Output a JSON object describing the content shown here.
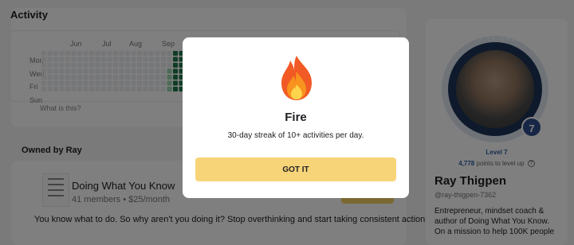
{
  "activity": {
    "title": "Activity",
    "months": [
      "Jun",
      "Jul",
      "Aug",
      "Sep"
    ],
    "days": [
      "Mon",
      "Wed",
      "Fri",
      "Sun"
    ],
    "help_link": "What is this?"
  },
  "owned": {
    "title": "Owned by Ray",
    "group": {
      "name": "Doing What You Know",
      "meta": "41 members • $25/month",
      "description": "You know what to do. So why aren't you doing it? Stop overthinking and start taking consistent action."
    }
  },
  "profile": {
    "avatar_text": "RAY THIGPEN",
    "level_badge": "7",
    "level_label": "Level 7",
    "points_value": "4,778",
    "points_suffix": " points to level up",
    "name": "Ray Thigpen",
    "handle": "@ray-thigpen-7362",
    "bio": "Entrepreneur, mindset coach & author of Doing What You Know. On a mission to help 100K people"
  },
  "modal": {
    "icon": "fire-icon",
    "title": "Fire",
    "text": "30-day streak of 10+ activities per day.",
    "button_label": "GOT IT"
  },
  "colors": {
    "accent": "#f8d479",
    "heat_active": "#1f7a4d",
    "level_blue": "#2f5ea3",
    "overlay": "rgba(0,0,0,0.5)"
  }
}
